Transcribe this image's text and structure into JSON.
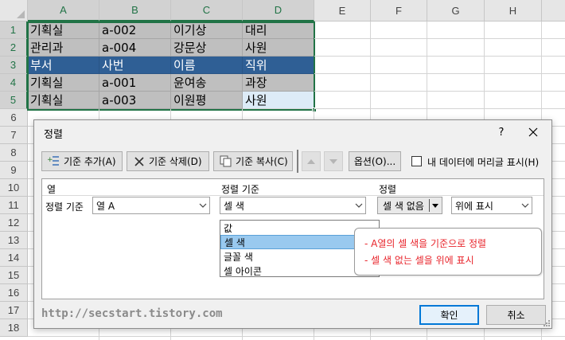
{
  "sheet": {
    "columns": [
      "A",
      "B",
      "C",
      "D",
      "E",
      "F",
      "G",
      "H"
    ],
    "rows": [
      "1",
      "2",
      "3",
      "4",
      "5",
      "6",
      "7",
      "8",
      "9",
      "10",
      "11",
      "12",
      "13",
      "14",
      "15",
      "16",
      "17",
      "18"
    ],
    "data": [
      [
        "기획실",
        "a-002",
        "이기상",
        "대리"
      ],
      [
        "관리과",
        "a-004",
        "강문상",
        "사원"
      ],
      [
        "부서",
        "사번",
        "이름",
        "직위"
      ],
      [
        "기획실",
        "a-001",
        "윤여송",
        "과장"
      ],
      [
        "기획실",
        "a-003",
        "이원평",
        "사원"
      ]
    ],
    "colors": {
      "gray_fill": "#bfbfbf",
      "header_fill": "#2f5f95",
      "highlight_fill": "#ddebf7",
      "selection_border": "#217346"
    }
  },
  "dialog": {
    "title": "정렬",
    "help": "?",
    "toolbar": {
      "add_level": "기준 추가(A)",
      "delete_level": "기준 삭제(D)",
      "copy_level": "기준 복사(C)",
      "options": "옵션(O)...",
      "header_checkbox_label": "내 데이터에 머리글 표시(H)",
      "header_checkbox_checked": false
    },
    "headers": {
      "column": "열",
      "sort_on": "정렬 기준",
      "order": "정렬"
    },
    "row": {
      "label": "정렬 기준",
      "column_value": "열 A",
      "sort_on_value": "셀 색",
      "color_value": "셀 색 없음",
      "position_value": "위에 표시"
    },
    "sort_on_options": [
      "값",
      "셀 색",
      "글꼴 색",
      "셀 아이콘"
    ],
    "sort_on_highlighted": "셀 색",
    "note": [
      "- A열의 셀 색을 기준으로 정렬",
      "- 셀 색 없는 셀을 위에 표시"
    ],
    "watermark": "http://secstart.tistory.com",
    "ok": "확인",
    "cancel": "취소"
  }
}
